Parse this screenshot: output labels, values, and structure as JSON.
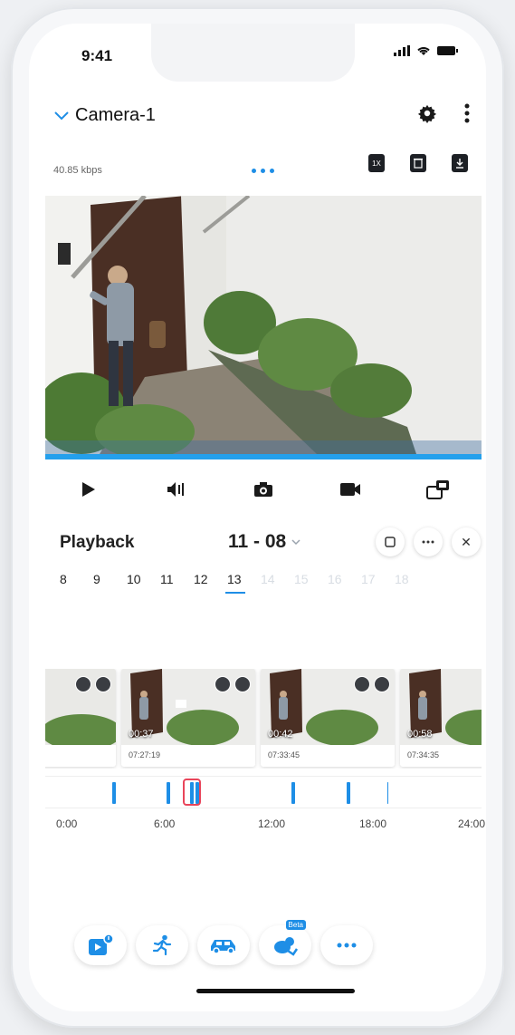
{
  "status": {
    "time": "9:41"
  },
  "header": {
    "title": "Camera-1"
  },
  "stream": {
    "bitrate": "40.85 kbps"
  },
  "top_tools": [
    {
      "label": "1X"
    },
    {
      "label": ""
    },
    {
      "label": ""
    }
  ],
  "playback": {
    "title": "Playback",
    "date": "11 - 08",
    "close_label": "✕"
  },
  "hours": [
    "8",
    "9",
    "10",
    "11",
    "12",
    "13",
    "14",
    "15",
    "16",
    "17",
    "18"
  ],
  "active_hour": "13",
  "clips": [
    {
      "duration": "",
      "time": ""
    },
    {
      "duration": "00:37",
      "time": "07:27:19"
    },
    {
      "duration": "00:42",
      "time": "07:33:45"
    },
    {
      "duration": "00:58",
      "time": "07:34:35"
    }
  ],
  "timeline": {
    "labels": [
      "0:00",
      "6:00",
      "12:00",
      "18:00",
      "24:00"
    ]
  },
  "bottom_bar": {
    "beta_label": "Beta"
  },
  "colors": {
    "accent": "#1e8ee6",
    "cursor": "#e9455a",
    "dark": "#1d2025"
  }
}
